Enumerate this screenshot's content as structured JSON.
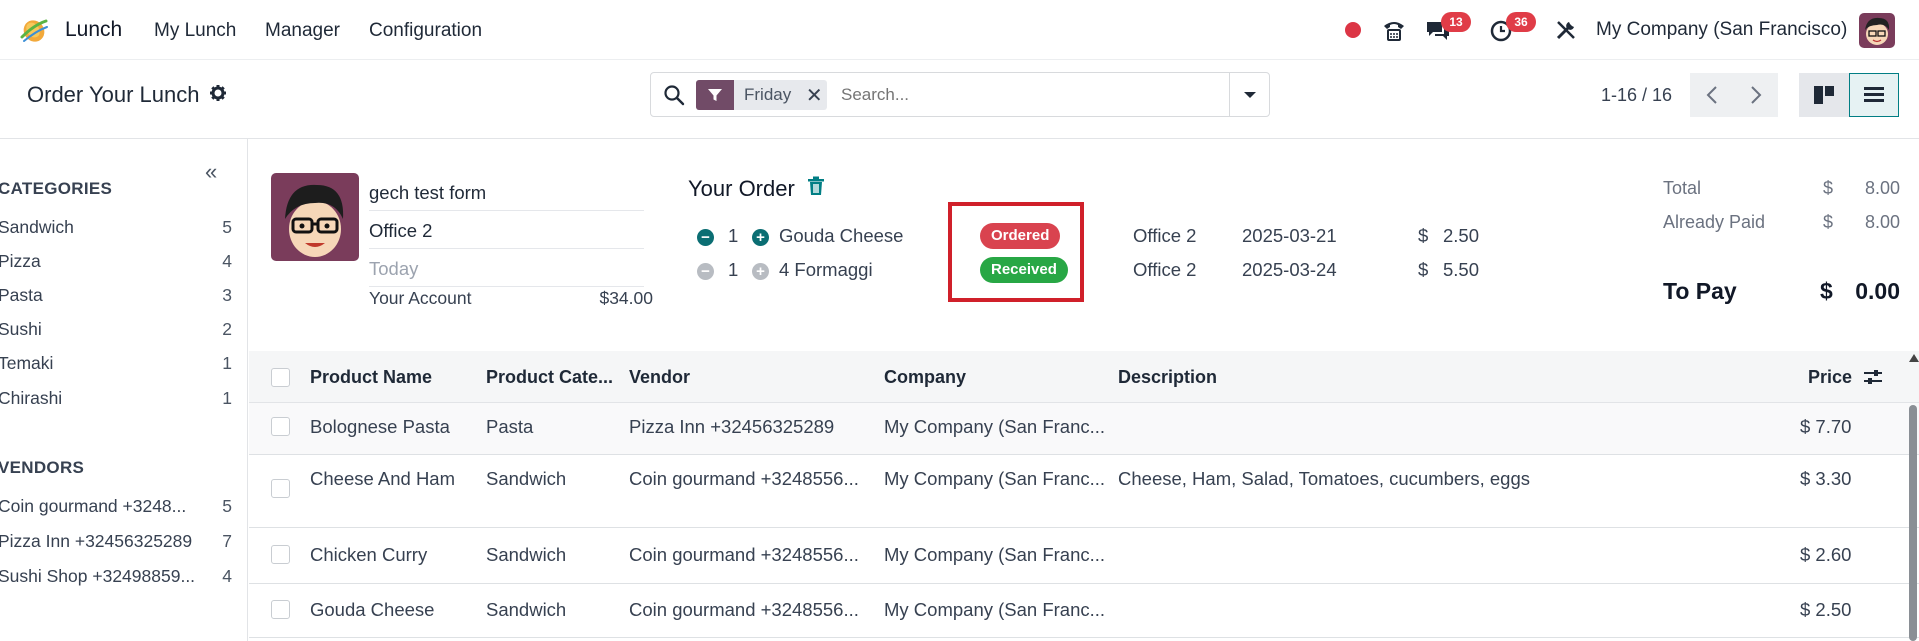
{
  "navbar": {
    "app_name": "Lunch",
    "menus": [
      "My Lunch",
      "Manager",
      "Configuration"
    ],
    "chat_badge": "13",
    "activity_badge": "36",
    "company": "My Company (San Francisco)"
  },
  "control_panel": {
    "title": "Order Your Lunch",
    "facet_value": "Friday",
    "search_placeholder": "Search...",
    "pager": "1-16 / 16"
  },
  "sidebar": {
    "collapse_glyph": "«",
    "categories_title": "CATEGORIES",
    "categories": [
      {
        "label": "Sandwich",
        "count": "5"
      },
      {
        "label": "Pizza",
        "count": "4"
      },
      {
        "label": "Pasta",
        "count": "3"
      },
      {
        "label": "Sushi",
        "count": "2"
      },
      {
        "label": "Temaki",
        "count": "1"
      },
      {
        "label": "Chirashi",
        "count": "1"
      }
    ],
    "vendors_title": "VENDORS",
    "vendors": [
      {
        "label": "Coin gourmand +3248...",
        "count": "5"
      },
      {
        "label": "Pizza Inn +32456325289",
        "count": "7"
      },
      {
        "label": "Sushi Shop +32498859...",
        "count": "4"
      }
    ]
  },
  "user": {
    "name": "gech test form",
    "location": "Office 2",
    "date": "Today",
    "account_label": "Your Account",
    "account_amount": "$34.00"
  },
  "order": {
    "title": "Your Order",
    "lines": [
      {
        "qty": "1",
        "product": "Gouda Cheese",
        "status": "Ordered",
        "status_color": "#d9434f",
        "location": "Office 2",
        "date": "2025-03-21",
        "currency": "$",
        "price": "2.50"
      },
      {
        "qty": "1",
        "product": "4 Formaggi",
        "status": "Received",
        "status_color": "#28a745",
        "location": "Office 2",
        "date": "2025-03-24",
        "currency": "$",
        "price": "5.50"
      }
    ]
  },
  "totals": {
    "total_label": "Total",
    "total_currency": "$",
    "total_amount": "8.00",
    "paid_label": "Already Paid",
    "paid_currency": "$",
    "paid_amount": "8.00",
    "topay_label": "To Pay",
    "topay_currency": "$",
    "topay_amount": "0.00"
  },
  "table": {
    "columns": [
      "Product Name",
      "Product Cate...",
      "Vendor",
      "Company",
      "Description",
      "Price"
    ],
    "rows": [
      {
        "name": "Bolognese Pasta",
        "category": "Pasta",
        "vendor": "Pizza Inn +32456325289",
        "company": "My Company (San Franc...",
        "description": "",
        "price": "$ 7.70"
      },
      {
        "name": "Cheese And Ham",
        "category": "Sandwich",
        "vendor": "Coin gourmand +3248556...",
        "company": "My Company (San Franc...",
        "description": "Cheese, Ham, Salad, Tomatoes, cucumbers, eggs",
        "price": "$ 3.30"
      },
      {
        "name": "Chicken Curry",
        "category": "Sandwich",
        "vendor": "Coin gourmand +3248556...",
        "company": "My Company (San Franc...",
        "description": "",
        "price": "$ 2.60"
      },
      {
        "name": "Gouda Cheese",
        "category": "Sandwich",
        "vendor": "Coin gourmand +3248556...",
        "company": "My Company (San Franc...",
        "description": "",
        "price": "$ 2.50"
      }
    ]
  },
  "colors": {
    "brand": "#714b67",
    "teal": "#017e84",
    "badge_red": "#e03c47",
    "highlight_red": "#d0202a"
  }
}
